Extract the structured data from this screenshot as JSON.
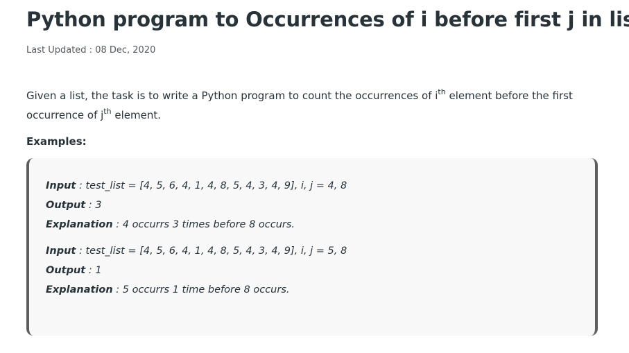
{
  "article": {
    "title": "Python program to Occurrences of i before first j in list",
    "last_updated": "Last Updated : 08 Dec, 2020",
    "intro": {
      "part1": "Given a list, the task is to write a Python program to count the occurrences of i",
      "sup1": "th",
      "part2": " element before the first occurrence of j",
      "sup2": "th",
      "part3": " element."
    },
    "examples_heading": "Examples:",
    "examples": [
      {
        "input_key": "Input",
        "input_val": " : test_list = [4, 5, 6, 4, 1, 4, 8, 5, 4, 3, 4, 9], i, j = 4, 8",
        "output_key": "Output",
        "output_val": " : 3",
        "explanation_key": "Explanation",
        "explanation_val": " : 4 occurrs 3 times before 8 occurs."
      },
      {
        "input_key": "Input",
        "input_val": " : test_list = [4, 5, 6, 4, 1, 4, 8, 5, 4, 3, 4, 9], i, j = 5, 8",
        "output_key": "Output",
        "output_val": " : 1",
        "explanation_key": "Explanation",
        "explanation_val": " : 5 occurrs 1 time before 8 occurs."
      }
    ]
  },
  "colors": {
    "text": "#273239",
    "muted": "#555a5e",
    "box_background": "#f8f8f8",
    "box_border": "#5e5e5e"
  }
}
